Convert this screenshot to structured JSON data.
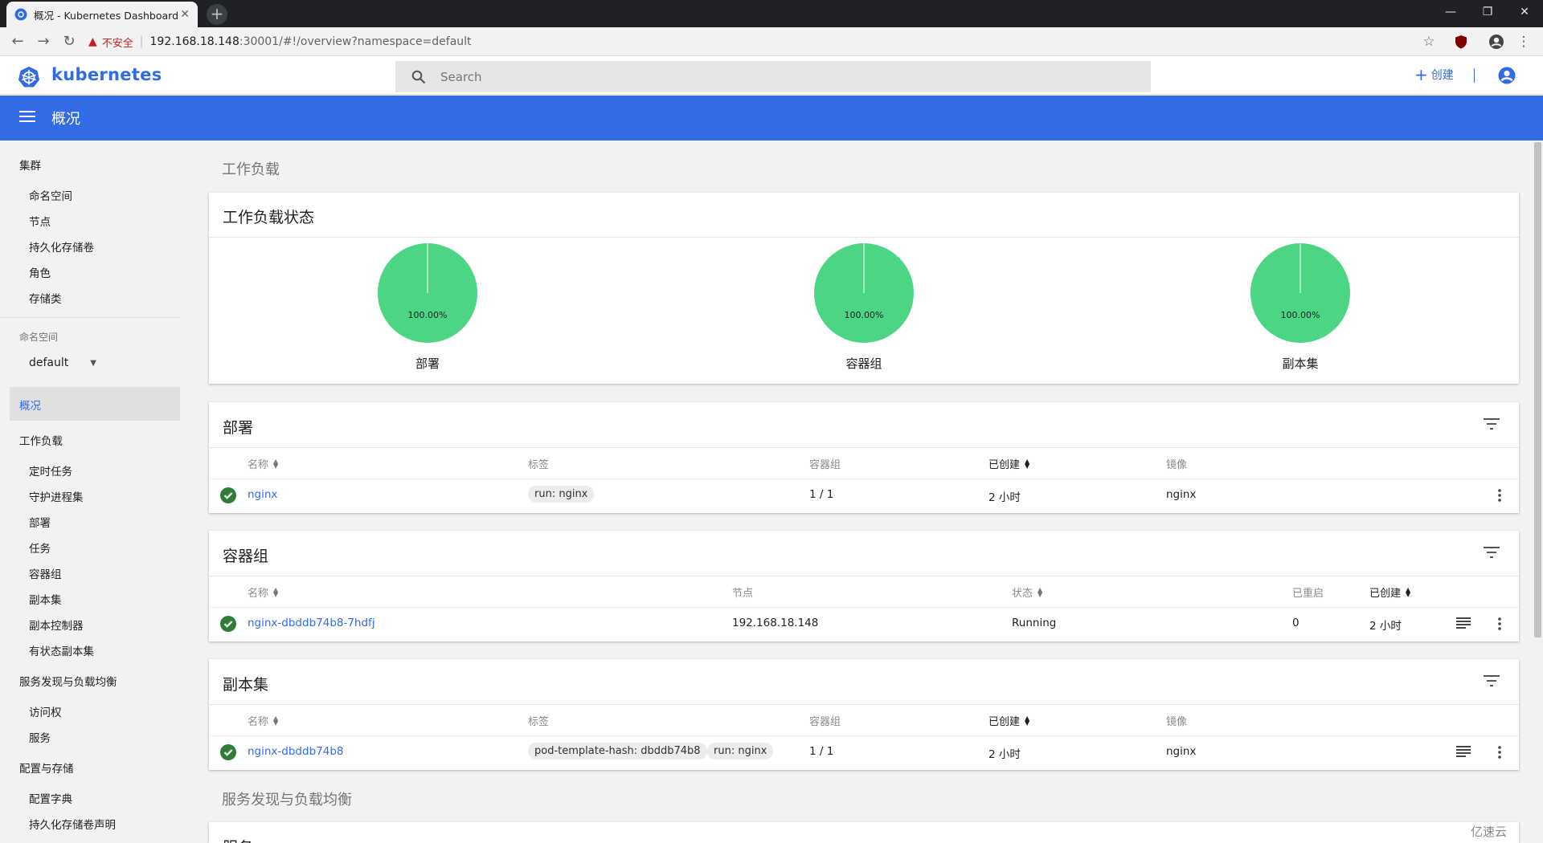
{
  "browser": {
    "tab_title": "概况 - Kubernetes Dashboard",
    "tab_close": "✕",
    "new_tab": "+",
    "insecure_label": "不安全",
    "url_host": "192.168.18.148",
    "url_rest": ":30001/#!/overview?namespace=default",
    "window_controls": [
      "—",
      "❐",
      "✕"
    ]
  },
  "header": {
    "brand": "kubernetes",
    "search_placeholder": "Search",
    "create_label": "创建"
  },
  "title_bar": {
    "page_title": "概况"
  },
  "sidebar": {
    "cluster": {
      "label": "集群",
      "items": [
        "命名空间",
        "节点",
        "持久化存储卷",
        "角色",
        "存储类"
      ]
    },
    "namespace": {
      "label": "命名空间",
      "value": "default"
    },
    "overview": "概况",
    "workloads": {
      "label": "工作负载",
      "items": [
        "定时任务",
        "守护进程集",
        "部署",
        "任务",
        "容器组",
        "副本集",
        "副本控制器",
        "有状态副本集"
      ]
    },
    "discovery": {
      "label": "服务发现与负载均衡",
      "items": [
        "访问权",
        "服务"
      ]
    },
    "config": {
      "label": "配置与存储",
      "items": [
        "配置字典",
        "持久化存储卷声明"
      ]
    }
  },
  "main": {
    "workloads_heading": "工作负载",
    "status_card": {
      "title": "工作负载状态",
      "charts": [
        {
          "name": "部署",
          "label": "100.00%",
          "percent": 100,
          "color": "#4cd684"
        },
        {
          "name": "容器组",
          "label": "100.00%",
          "percent": 100,
          "color": "#4cd684"
        },
        {
          "name": "副本集",
          "label": "100.00%",
          "percent": 100,
          "color": "#4cd684"
        }
      ]
    },
    "deployments": {
      "title": "部署",
      "headers": {
        "name": "名称",
        "labels": "标签",
        "pods": "容器组",
        "created": "已创建",
        "images": "镜像"
      },
      "rows": [
        {
          "name": "nginx",
          "labels": [
            "run: nginx"
          ],
          "pods": "1 / 1",
          "created": "2 小时",
          "images": "nginx"
        }
      ]
    },
    "pods": {
      "title": "容器组",
      "headers": {
        "name": "名称",
        "node": "节点",
        "status": "状态",
        "restarts": "已重启",
        "created": "已创建"
      },
      "rows": [
        {
          "name": "nginx-dbddb74b8-7hdfj",
          "node": "192.168.18.148",
          "status": "Running",
          "restarts": "0",
          "created": "2 小时"
        }
      ]
    },
    "replicasets": {
      "title": "副本集",
      "headers": {
        "name": "名称",
        "labels": "标签",
        "pods": "容器组",
        "created": "已创建",
        "images": "镜像"
      },
      "rows": [
        {
          "name": "nginx-dbddb74b8",
          "labels": [
            "pod-template-hash: dbddb74b8",
            "run: nginx"
          ],
          "pods": "1 / 1",
          "created": "2 小时",
          "images": "nginx"
        }
      ]
    },
    "discovery_heading": "服务发现与负载均衡",
    "services_title": "服务"
  },
  "watermark": "亿速云",
  "colors": {
    "primary": "#326ce5",
    "success": "#2e7d32",
    "chart_green": "#4cd684"
  }
}
